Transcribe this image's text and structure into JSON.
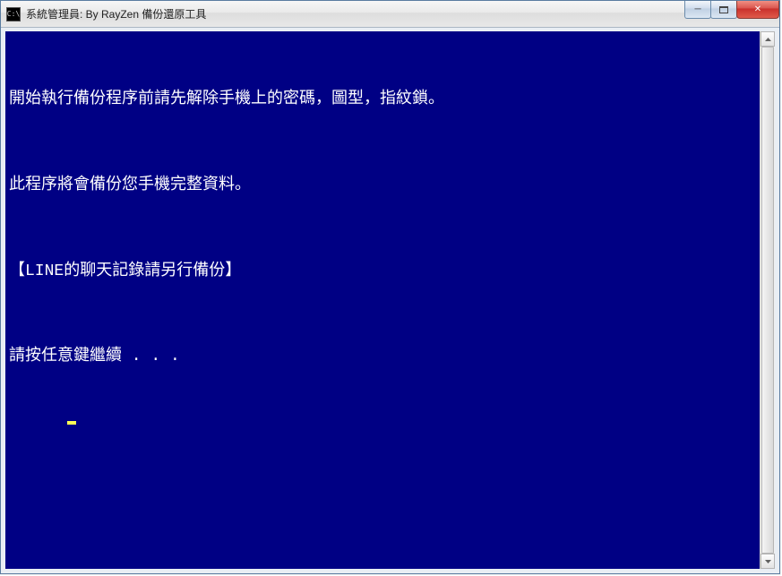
{
  "window": {
    "title": "系統管理員: By RayZen 備份還原工具",
    "icon_label": "C:\\"
  },
  "controls": {
    "minimize_glyph": "─",
    "close_glyph": "✕"
  },
  "console": {
    "lines": [
      "開始執行備份程序前請先解除手機上的密碼，圖型，指紋鎖。",
      "此程序將會備份您手機完整資料。",
      "【LINE的聊天記錄請另行備份】",
      "請按任意鍵繼續 . . ."
    ]
  },
  "colors": {
    "console_bg": "#000084",
    "console_fg": "#ffffff",
    "cursor": "#ffff55"
  }
}
